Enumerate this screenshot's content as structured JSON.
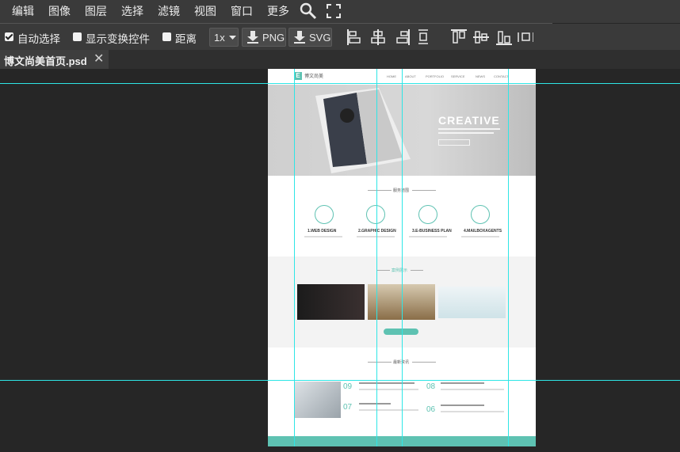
{
  "menu": {
    "items": [
      "编辑",
      "图像",
      "图层",
      "选择",
      "滤镜",
      "视图",
      "窗口",
      "更多"
    ]
  },
  "toolbar": {
    "auto_select_label": "自动选择",
    "show_transform_label": "显示变换控件",
    "distance_label": "距离",
    "zoom_value": "1x",
    "png_label": "PNG",
    "svg_label": "SVG"
  },
  "tab": {
    "title": "博文尚美首页.psd"
  },
  "design": {
    "logo_text": "博文尚美",
    "nav": [
      "HOME",
      "ABOUT",
      "PORTFOLIO",
      "SERVICE",
      "NEWS",
      "CONTACT"
    ],
    "hero_title": "CREATIVE",
    "services_heading": "服务范围",
    "services": [
      {
        "title": "1.WEB DESIGN"
      },
      {
        "title": "2.GRAPHIC DESIGN"
      },
      {
        "title": "3.E-BUSINESS PLAN"
      },
      {
        "title": "4.MAILBOXAGENTS"
      }
    ],
    "cases_heading": "案例展示",
    "news_heading": "最新资讯",
    "news_dates": [
      "09",
      "08",
      "07",
      "06"
    ],
    "accent_color": "#5ec2b2"
  },
  "colors": {
    "guide": "#2ee6e6",
    "menubar_bg": "#3a3a3a",
    "workspace_bg": "#262626"
  }
}
